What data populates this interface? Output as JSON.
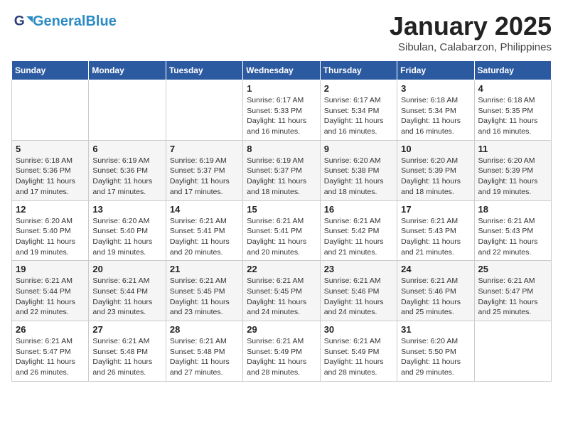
{
  "logo": {
    "line1": "General",
    "line2": "Blue"
  },
  "calendar": {
    "title": "January 2025",
    "subtitle": "Sibulan, Calabarzon, Philippines",
    "weekdays": [
      "Sunday",
      "Monday",
      "Tuesday",
      "Wednesday",
      "Thursday",
      "Friday",
      "Saturday"
    ],
    "weeks": [
      [
        {
          "day": "",
          "info": ""
        },
        {
          "day": "",
          "info": ""
        },
        {
          "day": "",
          "info": ""
        },
        {
          "day": "1",
          "info": "Sunrise: 6:17 AM\nSunset: 5:33 PM\nDaylight: 11 hours\nand 16 minutes."
        },
        {
          "day": "2",
          "info": "Sunrise: 6:17 AM\nSunset: 5:34 PM\nDaylight: 11 hours\nand 16 minutes."
        },
        {
          "day": "3",
          "info": "Sunrise: 6:18 AM\nSunset: 5:34 PM\nDaylight: 11 hours\nand 16 minutes."
        },
        {
          "day": "4",
          "info": "Sunrise: 6:18 AM\nSunset: 5:35 PM\nDaylight: 11 hours\nand 16 minutes."
        }
      ],
      [
        {
          "day": "5",
          "info": "Sunrise: 6:18 AM\nSunset: 5:36 PM\nDaylight: 11 hours\nand 17 minutes."
        },
        {
          "day": "6",
          "info": "Sunrise: 6:19 AM\nSunset: 5:36 PM\nDaylight: 11 hours\nand 17 minutes."
        },
        {
          "day": "7",
          "info": "Sunrise: 6:19 AM\nSunset: 5:37 PM\nDaylight: 11 hours\nand 17 minutes."
        },
        {
          "day": "8",
          "info": "Sunrise: 6:19 AM\nSunset: 5:37 PM\nDaylight: 11 hours\nand 18 minutes."
        },
        {
          "day": "9",
          "info": "Sunrise: 6:20 AM\nSunset: 5:38 PM\nDaylight: 11 hours\nand 18 minutes."
        },
        {
          "day": "10",
          "info": "Sunrise: 6:20 AM\nSunset: 5:39 PM\nDaylight: 11 hours\nand 18 minutes."
        },
        {
          "day": "11",
          "info": "Sunrise: 6:20 AM\nSunset: 5:39 PM\nDaylight: 11 hours\nand 19 minutes."
        }
      ],
      [
        {
          "day": "12",
          "info": "Sunrise: 6:20 AM\nSunset: 5:40 PM\nDaylight: 11 hours\nand 19 minutes."
        },
        {
          "day": "13",
          "info": "Sunrise: 6:20 AM\nSunset: 5:40 PM\nDaylight: 11 hours\nand 19 minutes."
        },
        {
          "day": "14",
          "info": "Sunrise: 6:21 AM\nSunset: 5:41 PM\nDaylight: 11 hours\nand 20 minutes."
        },
        {
          "day": "15",
          "info": "Sunrise: 6:21 AM\nSunset: 5:41 PM\nDaylight: 11 hours\nand 20 minutes."
        },
        {
          "day": "16",
          "info": "Sunrise: 6:21 AM\nSunset: 5:42 PM\nDaylight: 11 hours\nand 21 minutes."
        },
        {
          "day": "17",
          "info": "Sunrise: 6:21 AM\nSunset: 5:43 PM\nDaylight: 11 hours\nand 21 minutes."
        },
        {
          "day": "18",
          "info": "Sunrise: 6:21 AM\nSunset: 5:43 PM\nDaylight: 11 hours\nand 22 minutes."
        }
      ],
      [
        {
          "day": "19",
          "info": "Sunrise: 6:21 AM\nSunset: 5:44 PM\nDaylight: 11 hours\nand 22 minutes."
        },
        {
          "day": "20",
          "info": "Sunrise: 6:21 AM\nSunset: 5:44 PM\nDaylight: 11 hours\nand 23 minutes."
        },
        {
          "day": "21",
          "info": "Sunrise: 6:21 AM\nSunset: 5:45 PM\nDaylight: 11 hours\nand 23 minutes."
        },
        {
          "day": "22",
          "info": "Sunrise: 6:21 AM\nSunset: 5:45 PM\nDaylight: 11 hours\nand 24 minutes."
        },
        {
          "day": "23",
          "info": "Sunrise: 6:21 AM\nSunset: 5:46 PM\nDaylight: 11 hours\nand 24 minutes."
        },
        {
          "day": "24",
          "info": "Sunrise: 6:21 AM\nSunset: 5:46 PM\nDaylight: 11 hours\nand 25 minutes."
        },
        {
          "day": "25",
          "info": "Sunrise: 6:21 AM\nSunset: 5:47 PM\nDaylight: 11 hours\nand 25 minutes."
        }
      ],
      [
        {
          "day": "26",
          "info": "Sunrise: 6:21 AM\nSunset: 5:47 PM\nDaylight: 11 hours\nand 26 minutes."
        },
        {
          "day": "27",
          "info": "Sunrise: 6:21 AM\nSunset: 5:48 PM\nDaylight: 11 hours\nand 26 minutes."
        },
        {
          "day": "28",
          "info": "Sunrise: 6:21 AM\nSunset: 5:48 PM\nDaylight: 11 hours\nand 27 minutes."
        },
        {
          "day": "29",
          "info": "Sunrise: 6:21 AM\nSunset: 5:49 PM\nDaylight: 11 hours\nand 28 minutes."
        },
        {
          "day": "30",
          "info": "Sunrise: 6:21 AM\nSunset: 5:49 PM\nDaylight: 11 hours\nand 28 minutes."
        },
        {
          "day": "31",
          "info": "Sunrise: 6:20 AM\nSunset: 5:50 PM\nDaylight: 11 hours\nand 29 minutes."
        },
        {
          "day": "",
          "info": ""
        }
      ]
    ]
  }
}
